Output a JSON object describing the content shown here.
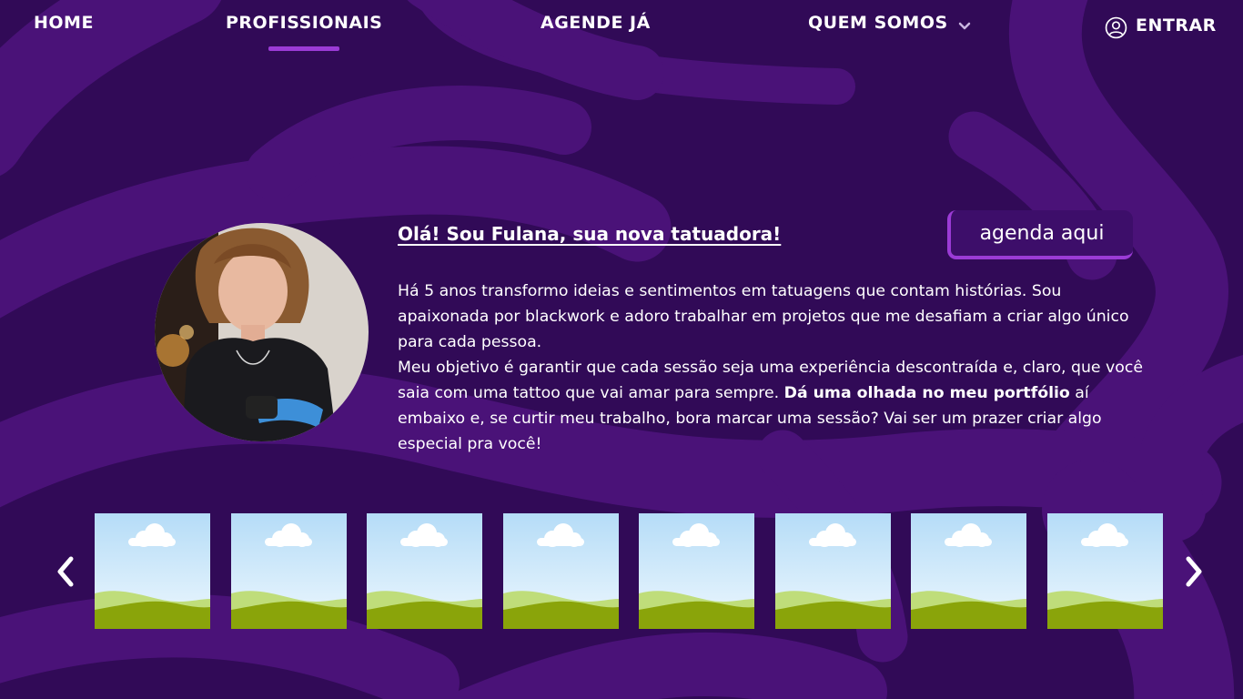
{
  "nav": {
    "home": "HOME",
    "profissionais": "PROFISSIONAIS",
    "agende": "AGENDE JÁ",
    "quem_somos": "QUEM SOMOS",
    "entrar": "ENTRAR"
  },
  "profile": {
    "greeting": "Olá! Sou Fulana, sua nova tatuadora!",
    "cta_label": "agenda aqui",
    "bio_1": "Há 5 anos transformo ideias e sentimentos em tatuagens que contam histórias. Sou apaixonada por blackwork e adoro trabalhar em projetos que me desafiam a criar algo único para cada pessoa.",
    "bio_2_start": "Meu objetivo é garantir que cada sessão seja uma experiência descontraída e, claro, que você saia com uma tattoo que vai amar para sempre. ",
    "bio_2_bold": "Dá uma olhada no meu portfólio",
    "bio_2_end": " aí embaixo e, se curtir meu trabalho, bora marcar uma sessão? Vai ser um prazer criar algo especial pra você!"
  },
  "gallery": {
    "prev_icon": "chevron-left-icon",
    "next_icon": "chevron-right-icon",
    "item_count": 8
  },
  "colors": {
    "background": "#310a57",
    "swirl": "#4a1278",
    "accent": "#9b3bd6",
    "button": "#3d0e6a"
  }
}
